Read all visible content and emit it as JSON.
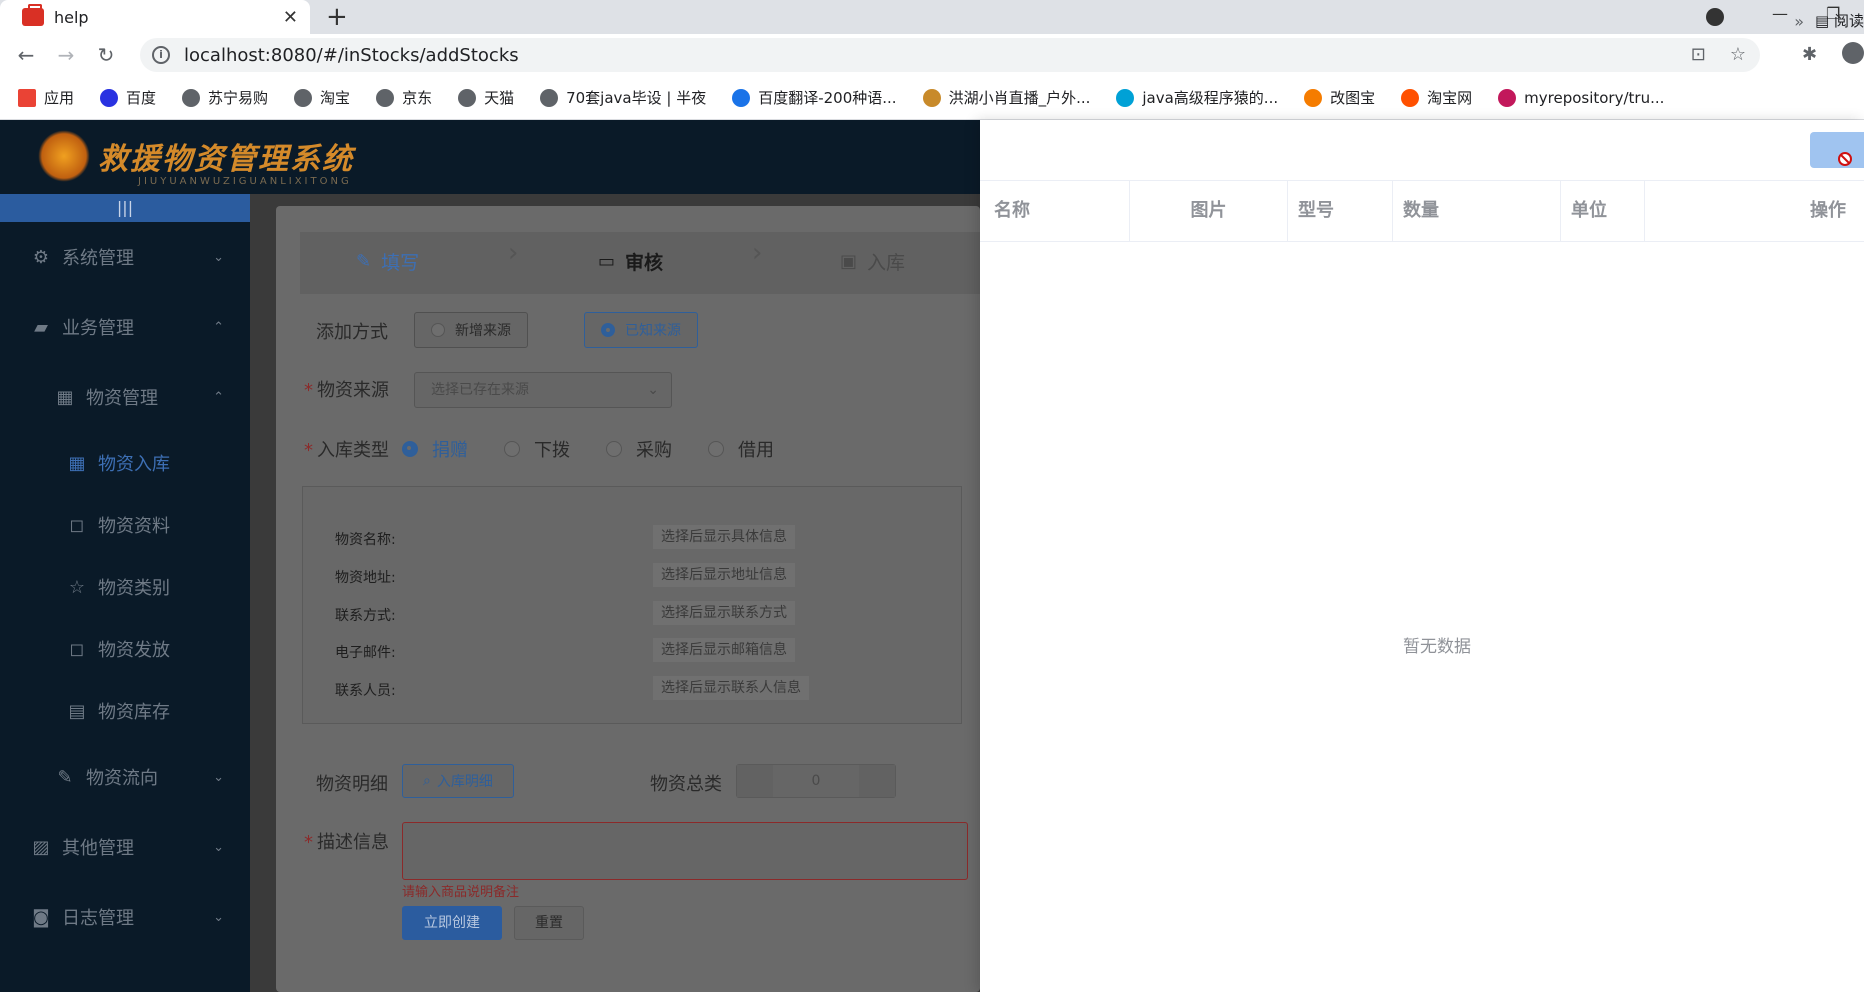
{
  "browser": {
    "tab_title": "help",
    "url_host": "localhost:8080/#/inStocks/addStocks",
    "bookmarks": [
      {
        "label": "应用",
        "color": "#ea4335"
      },
      {
        "label": "百度",
        "color": "#2932e1"
      },
      {
        "label": "苏宁易购",
        "color": "#5f6368"
      },
      {
        "label": "淘宝",
        "color": "#5f6368"
      },
      {
        "label": "京东",
        "color": "#5f6368"
      },
      {
        "label": "天猫",
        "color": "#5f6368"
      },
      {
        "label": "70套java毕设 | 半夜",
        "color": "#5f6368"
      },
      {
        "label": "百度翻译-200种语...",
        "color": "#1a73e8"
      },
      {
        "label": "洪湖小肖直播_户外...",
        "color": "#c88a2a"
      },
      {
        "label": "java高级程序猿的...",
        "color": "#00a1d6"
      },
      {
        "label": "改图宝",
        "color": "#f57c00"
      },
      {
        "label": "淘宝网",
        "color": "#ff5000"
      },
      {
        "label": "myrepository/tru...",
        "color": "#c2185b"
      }
    ],
    "bookmarks_more": "»",
    "reading_list": "阅读"
  },
  "header": {
    "logo_text": "救援物资管理系统",
    "logo_sub": "JIUYUANWUZIGUANLIXITONG"
  },
  "sidebar": {
    "collapse": "|||",
    "items": [
      {
        "label": "系统管理",
        "icon": "gear-icon",
        "glyph": "⚙",
        "arrow": "⌄"
      },
      {
        "label": "业务管理",
        "icon": "briefcase-icon",
        "glyph": "▰",
        "arrow": "⌃"
      },
      {
        "label": "物资管理",
        "icon": "calendar-icon",
        "glyph": "▦",
        "arrow": "⌃"
      },
      {
        "label": "物资入库",
        "icon": "calendar-icon",
        "glyph": "▦"
      },
      {
        "label": "物资资料",
        "icon": "bag-icon",
        "glyph": "◻"
      },
      {
        "label": "物资类别",
        "icon": "star-icon",
        "glyph": "☆"
      },
      {
        "label": "物资发放",
        "icon": "bag-icon",
        "glyph": "◻"
      },
      {
        "label": "物资库存",
        "icon": "document-icon",
        "glyph": "▤"
      },
      {
        "label": "物资流向",
        "icon": "edit-icon",
        "glyph": "✎",
        "arrow": "⌄"
      },
      {
        "label": "其他管理",
        "icon": "chart-icon",
        "glyph": "▨",
        "arrow": "⌄"
      },
      {
        "label": "日志管理",
        "icon": "camera-icon",
        "glyph": "◙",
        "arrow": "⌄"
      }
    ]
  },
  "steps": [
    {
      "label": "填写",
      "icon": "edit-icon",
      "glyph": "✎"
    },
    {
      "label": "审核",
      "icon": "id-card-icon",
      "glyph": "▭"
    },
    {
      "label": "入库",
      "icon": "image-icon",
      "glyph": "▣"
    }
  ],
  "form": {
    "add_method_label": "添加方式",
    "add_method_options": [
      "新增来源",
      "已知来源"
    ],
    "source_label": "物资来源",
    "source_placeholder": "选择已存在来源",
    "type_label": "入库类型",
    "type_options": [
      "捐赠",
      "下拨",
      "采购",
      "借用"
    ],
    "info_rows": [
      {
        "label": "物资名称:",
        "value": "选择后显示具体信息"
      },
      {
        "label": "物资地址:",
        "value": "选择后显示地址信息"
      },
      {
        "label": "联系方式:",
        "value": "选择后显示联系方式"
      },
      {
        "label": "电子邮件:",
        "value": "选择后显示邮箱信息"
      },
      {
        "label": "联系人员:",
        "value": "选择后显示联系人信息"
      }
    ],
    "detail_label": "物资明细",
    "detail_button": "入库明细",
    "total_label": "物资总类",
    "total_value": "0",
    "desc_label": "描述信息",
    "desc_error": "请输入商品说明备注",
    "create_button": "立即创建",
    "reset_button": "重置"
  },
  "drawer": {
    "columns": [
      "名称",
      "图片",
      "型号",
      "数量",
      "单位",
      "操作"
    ],
    "empty_text": "暂无数据"
  }
}
